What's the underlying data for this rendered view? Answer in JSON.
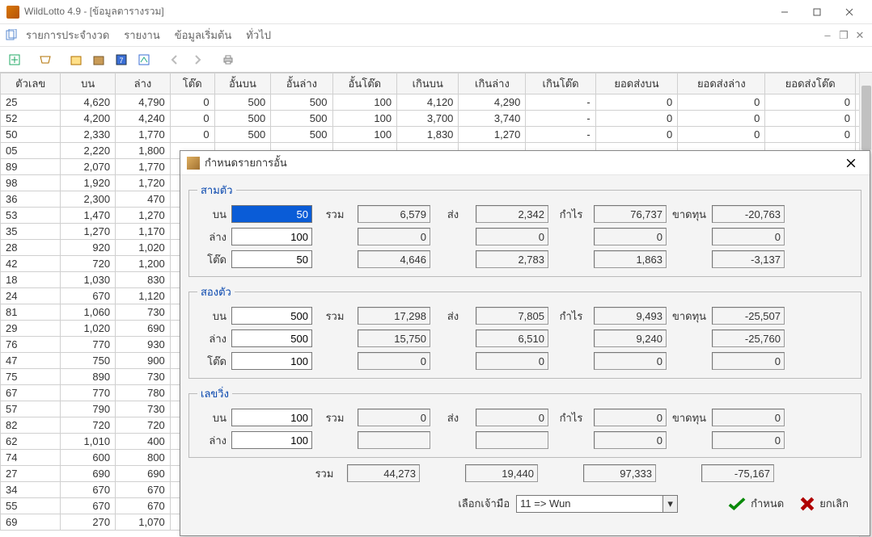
{
  "window": {
    "title": "WildLotto 4.9 - [ข้อมูลตารางรวม]"
  },
  "menu": {
    "items": [
      "รายการประจำงวด",
      "รายงาน",
      "ข้อมูลเริ่มต้น",
      "ทั่วไป"
    ]
  },
  "columns": [
    "ตัวเลข",
    "บน",
    "ล่าง",
    "โต๊ด",
    "อั้นบน",
    "อั้นล่าง",
    "อั้นโต๊ด",
    "เกินบน",
    "เกินล่าง",
    "เกินโต๊ด",
    "ยอดส่งบน",
    "ยอดส่งล่าง",
    "ยอดส่งโต๊ด"
  ],
  "rows": [
    [
      "25",
      "4,620",
      "4,790",
      "0",
      "500",
      "500",
      "100",
      "4,120",
      "4,290",
      "-",
      "0",
      "0",
      "0"
    ],
    [
      "52",
      "4,200",
      "4,240",
      "0",
      "500",
      "500",
      "100",
      "3,700",
      "3,740",
      "-",
      "0",
      "0",
      "0"
    ],
    [
      "50",
      "2,330",
      "1,770",
      "0",
      "500",
      "500",
      "100",
      "1,830",
      "1,270",
      "-",
      "0",
      "0",
      "0"
    ],
    [
      "05",
      "2,220",
      "1,800"
    ],
    [
      "89",
      "2,070",
      "1,770"
    ],
    [
      "98",
      "1,920",
      "1,720"
    ],
    [
      "36",
      "2,300",
      "470"
    ],
    [
      "53",
      "1,470",
      "1,270"
    ],
    [
      "35",
      "1,270",
      "1,170"
    ],
    [
      "28",
      "920",
      "1,020"
    ],
    [
      "42",
      "720",
      "1,200"
    ],
    [
      "18",
      "1,030",
      "830"
    ],
    [
      "24",
      "670",
      "1,120"
    ],
    [
      "81",
      "1,060",
      "730"
    ],
    [
      "29",
      "1,020",
      "690"
    ],
    [
      "76",
      "770",
      "930"
    ],
    [
      "47",
      "750",
      "900"
    ],
    [
      "75",
      "890",
      "730"
    ],
    [
      "67",
      "770",
      "780"
    ],
    [
      "57",
      "790",
      "730"
    ],
    [
      "82",
      "720",
      "720"
    ],
    [
      "62",
      "1,010",
      "400"
    ],
    [
      "74",
      "600",
      "800"
    ],
    [
      "27",
      "690",
      "690"
    ],
    [
      "34",
      "670",
      "670"
    ],
    [
      "55",
      "670",
      "670"
    ],
    [
      "69",
      "270",
      "1,070"
    ]
  ],
  "dialog": {
    "title": "กำหนดรายการอั้น",
    "groups": {
      "g3": {
        "legend": "สามตัว",
        "labels": {
          "bon": "บน",
          "lang": "ล่าง",
          "tod": "โต๊ด",
          "ruam": "รวม",
          "song": "ส่ง",
          "kamrai": "กำไร",
          "khadthun": "ขาดทุน"
        },
        "bon": {
          "inp": "50",
          "ruam": "6,579",
          "song": "2,342",
          "kamrai": "76,737",
          "khad": "-20,763"
        },
        "lang": {
          "inp": "100",
          "ruam": "0",
          "song": "0",
          "kamrai": "0",
          "khad": "0"
        },
        "tod": {
          "inp": "50",
          "ruam": "4,646",
          "song": "2,783",
          "kamrai": "1,863",
          "khad": "-3,137"
        }
      },
      "g2": {
        "legend": "สองตัว",
        "bon": {
          "inp": "500",
          "ruam": "17,298",
          "song": "7,805",
          "kamrai": "9,493",
          "khad": "-25,507"
        },
        "lang": {
          "inp": "500",
          "ruam": "15,750",
          "song": "6,510",
          "kamrai": "9,240",
          "khad": "-25,760"
        },
        "tod": {
          "inp": "100",
          "ruam": "0",
          "song": "0",
          "kamrai": "0",
          "khad": "0"
        }
      },
      "g1": {
        "legend": "เลขวิ่ง",
        "bon": {
          "inp": "100",
          "ruam": "0",
          "song": "0",
          "kamrai": "0",
          "khad": "0"
        },
        "lang": {
          "inp": "100",
          "ruam": "",
          "song": "",
          "kamrai": "0",
          "khad": "0"
        }
      }
    },
    "sum": {
      "label": "รวม",
      "ruam": "44,273",
      "song": "19,440",
      "kamrai": "97,333",
      "khad": "-75,167"
    },
    "footer": {
      "dealer_label": "เลือกเจ้ามือ",
      "dealer_value": "11 => Wun",
      "ok": "กำหนด",
      "cancel": "ยกเลิก"
    }
  }
}
